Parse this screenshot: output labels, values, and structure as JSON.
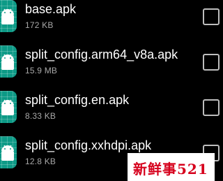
{
  "files": [
    {
      "name": "base.apk",
      "size": "172 KB",
      "icon": "android-icon"
    },
    {
      "name": "split_config.arm64_v8a.apk",
      "size": "15.9 MB",
      "icon": "android-icon"
    },
    {
      "name": "split_config.en.apk",
      "size": "8.33 KB",
      "icon": "android-icon"
    },
    {
      "name": "split_config.xxhdpi.apk",
      "size": "12.8 KB",
      "icon": "android-icon"
    }
  ],
  "watermark": {
    "text": "新鲜事521"
  },
  "colors": {
    "background": "#000000",
    "icon_tile": "#0d9a86",
    "name_text": "#ffffff",
    "size_text": "#a8a8a8",
    "watermark_text": "#d6001c"
  }
}
